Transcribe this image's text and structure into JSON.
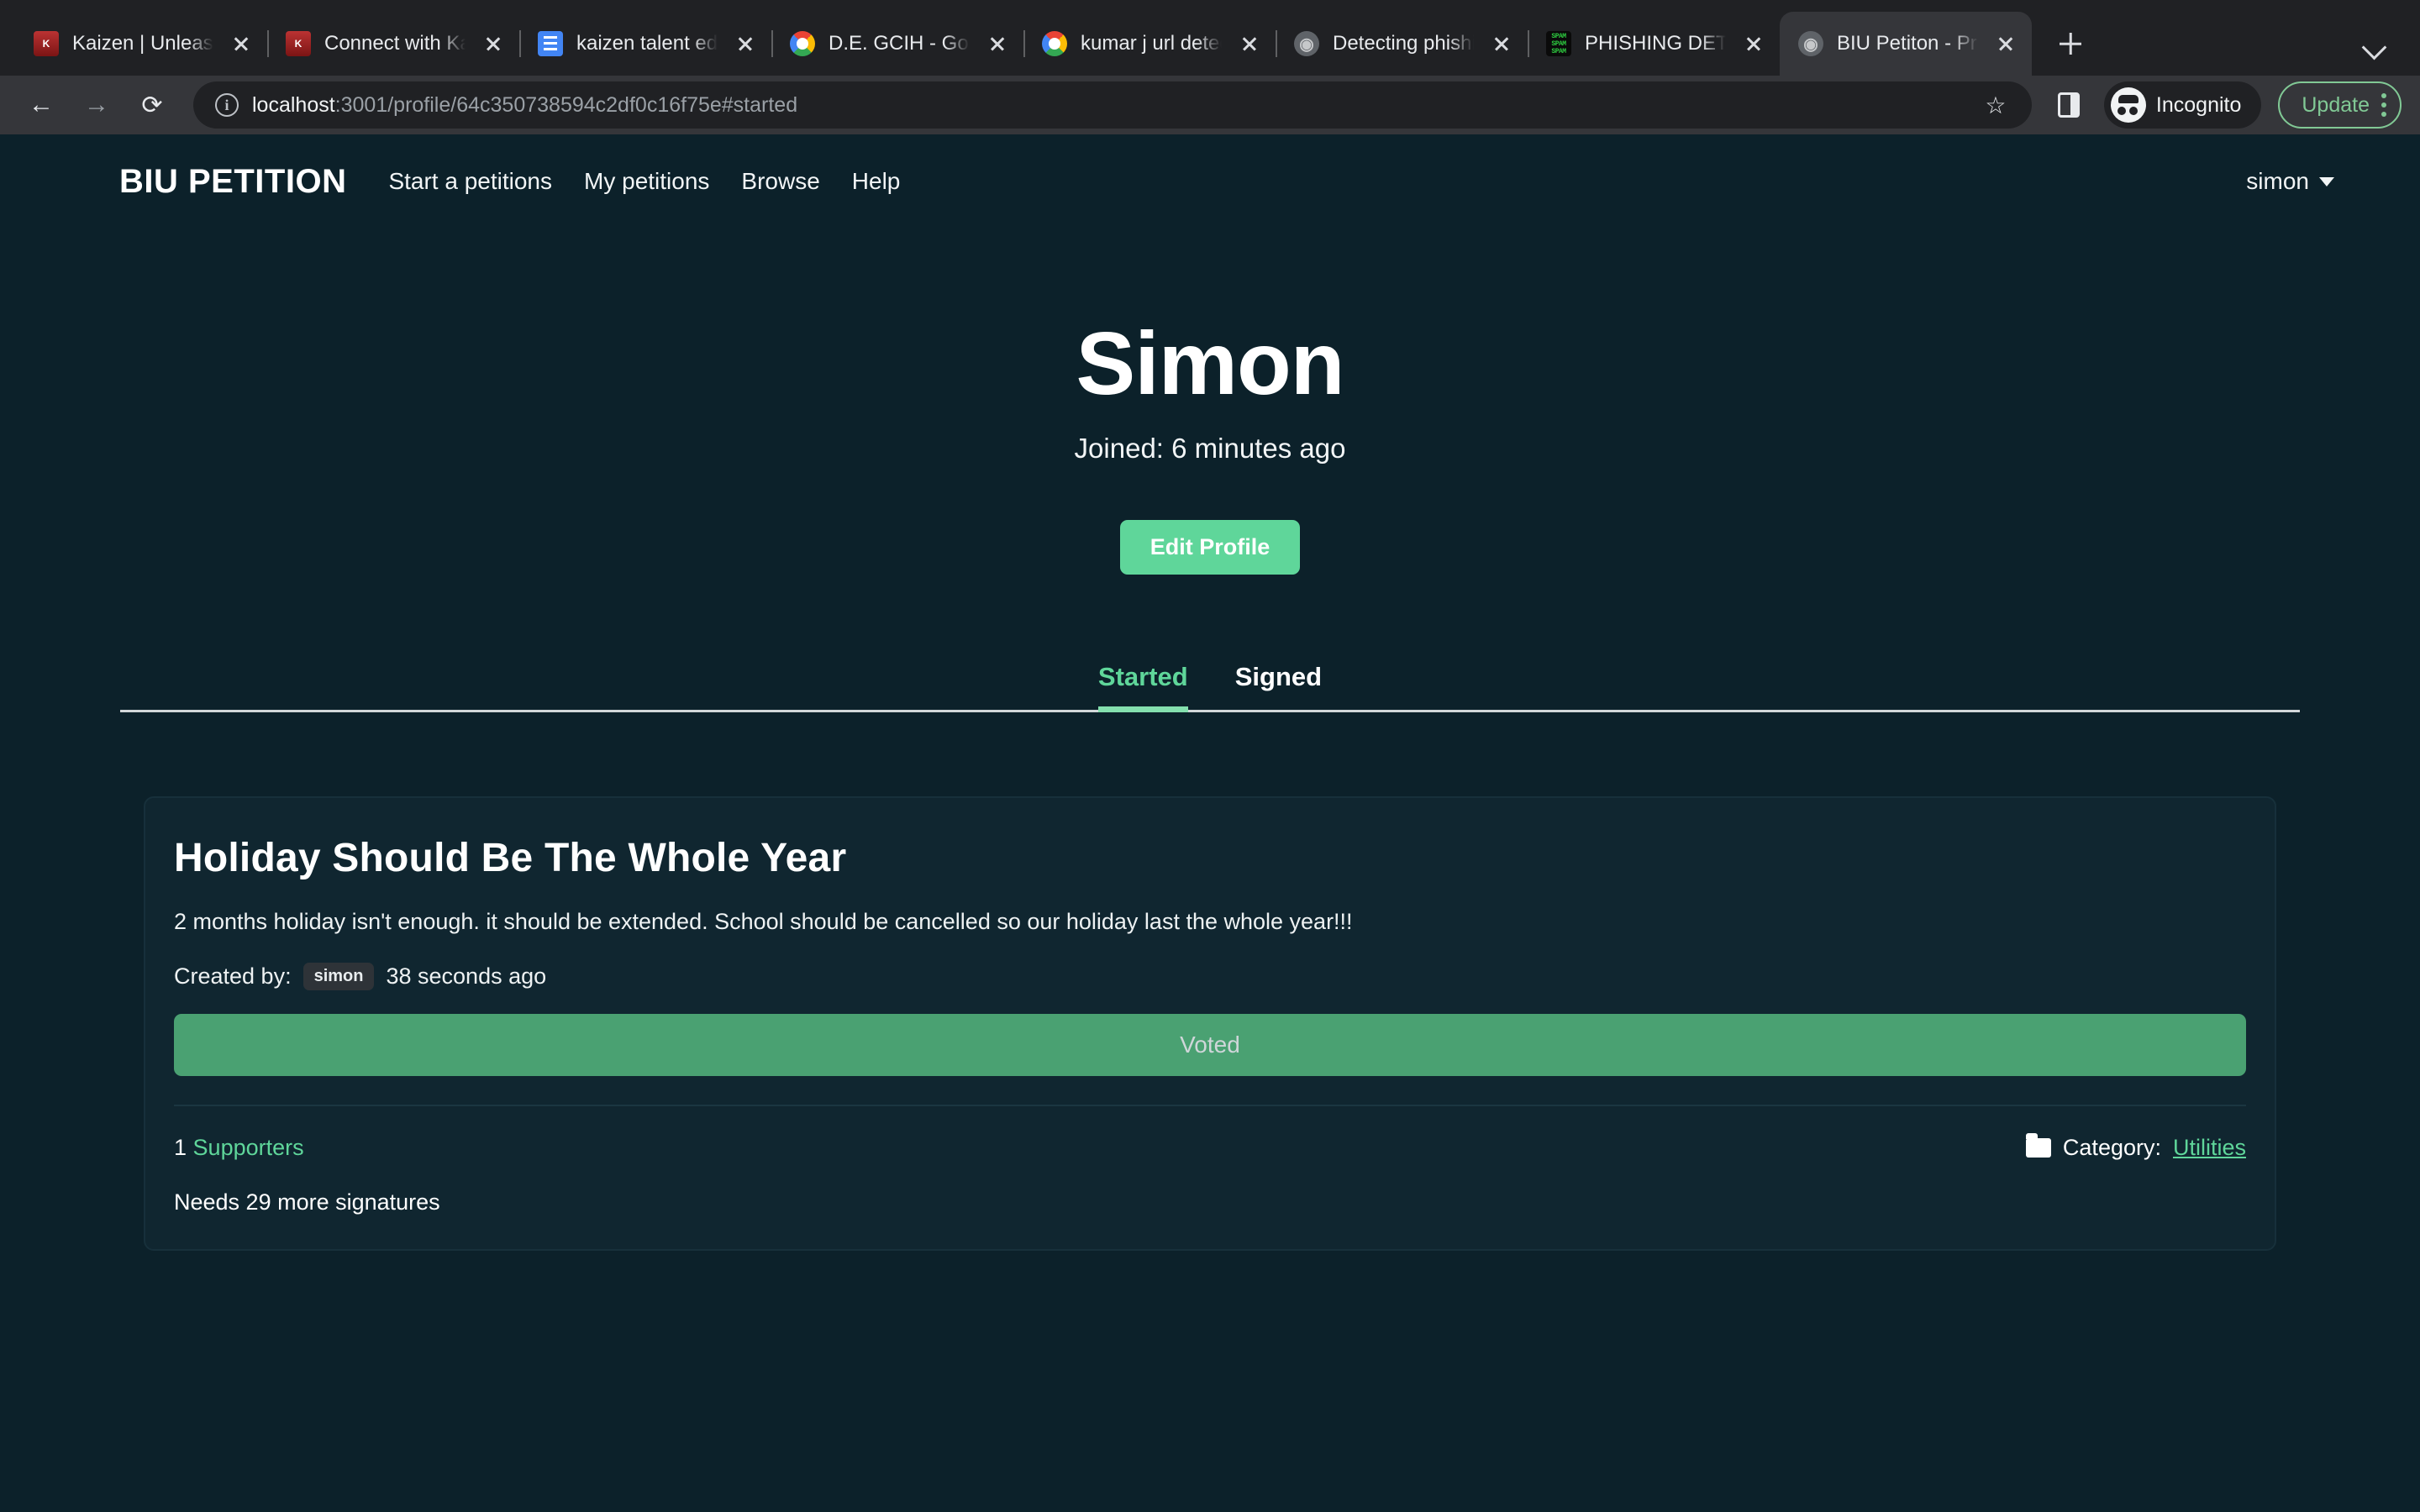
{
  "browser": {
    "tabs": [
      {
        "title": "Kaizen | Unleashing",
        "favicon": "kaizen-icon",
        "active": false
      },
      {
        "title": "Connect with Kaizen",
        "favicon": "kaizen-icon",
        "active": false
      },
      {
        "title": "kaizen talent edits",
        "favicon": "google-docs-icon",
        "active": false
      },
      {
        "title": "D.E. GCIH - Google",
        "favicon": "google-icon",
        "active": false
      },
      {
        "title": "kumar j url detect",
        "favicon": "google-icon",
        "active": false
      },
      {
        "title": "Detecting phishing",
        "favicon": "globe-icon",
        "active": false
      },
      {
        "title": "PHISHING DETECT",
        "favicon": "spam-icon",
        "active": false
      },
      {
        "title": "BIU Petiton - Profile",
        "favicon": "globe-icon",
        "active": true
      }
    ],
    "new_tab_label": "+",
    "tab_search_icon": "chevron-down-icon",
    "back_icon": "arrow-left-icon",
    "forward_icon": "arrow-right-icon",
    "reload_icon": "reload-icon",
    "url_host": "localhost",
    "url_path": ":3001/profile/64c350738594c2df0c16f75e#started",
    "url_full": "localhost:3001/profile/64c350738594c2df0c16f75e#started",
    "site_info_icon": "info-circle-icon",
    "bookmark_icon": "star-icon",
    "side_panel_icon": "side-panel-icon",
    "incognito_label": "Incognito",
    "incognito_icon": "incognito-icon",
    "update_label": "Update",
    "menu_icon": "kebab-menu-icon",
    "accent_green": "#81c995"
  },
  "site": {
    "brand": "BIU PETITION",
    "nav_links": [
      {
        "label": "Start a petitions"
      },
      {
        "label": "My petitions"
      },
      {
        "label": "Browse"
      },
      {
        "label": "Help"
      }
    ],
    "user_menu": {
      "label": "simon",
      "caret": "caret-down-icon"
    },
    "hero": {
      "name": "Simon",
      "joined": "Joined: 6 minutes ago",
      "edit_profile_label": "Edit Profile"
    },
    "tabs": [
      {
        "label": "Started",
        "active": true
      },
      {
        "label": "Signed",
        "active": false
      }
    ],
    "petition": {
      "title": "Holiday Should Be The Whole Year",
      "description": "2 months holiday isn't enough. it should be extended. School should be cancelled so our holiday last the whole year!!!",
      "created_by_label": "Created by:",
      "author": "simon",
      "created_time": "38 seconds ago",
      "vote_button_label": "Voted",
      "supporters_count": "1",
      "supporters_label": "Supporters",
      "category_icon": "folder-icon",
      "category_label": "Category:",
      "category_value": "Utilities",
      "needs_text": "Needs 29 more signatures"
    },
    "colors": {
      "page_bg": "#0c212a",
      "card_bg": "#102630",
      "accent_green": "#5fd69a",
      "voted_green": "#4aa172"
    }
  }
}
